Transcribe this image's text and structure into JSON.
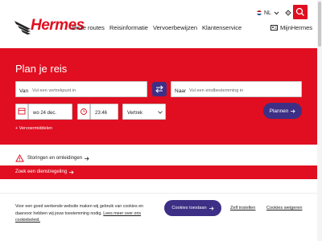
{
  "brand": {
    "name": "Hermes",
    "accent": "#e00e20",
    "secondary": "#3d2f86"
  },
  "nav": [
    {
      "label": "Onze routes"
    },
    {
      "label": "Reisinformatie"
    },
    {
      "label": "Vervoerbewijzen"
    },
    {
      "label": "Klantenservice"
    }
  ],
  "header": {
    "language": "NL",
    "account_label": "MijnHermes",
    "search_icon": "search-icon"
  },
  "planner": {
    "title": "Plan je reis",
    "from_label": "Van",
    "from_placeholder": "Vul een vertrekpunt in",
    "to_label": "Naar",
    "to_placeholder": "Vul een eindbestemming in",
    "date": "wo 24 dec.",
    "time": "23:46",
    "mode": "Vertrek",
    "submit": "Plannen",
    "options_link": "+ Vervoermiddelen"
  },
  "alerts": {
    "disruptions": "Storingen en omleidingen",
    "find_service": "Zoek een dienstregeling"
  },
  "cookie": {
    "text_1": "Voor een goed werkende website maken wij gebruik van cookies en daarvoor hebben wij jouw toestemming nodig.",
    "link": "Lees meer over ons cookiebeleid.",
    "accept": "Cookies toestaan",
    "settings": "Zelf instellen",
    "reject": "Cookies weigeren"
  }
}
